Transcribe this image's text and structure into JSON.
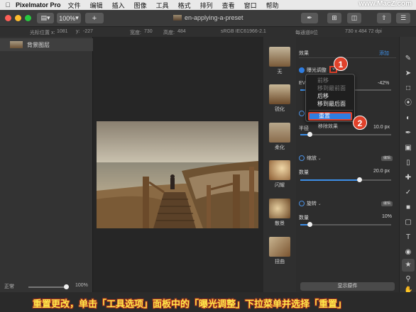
{
  "menubar": {
    "app_name": "Pixelmator Pro",
    "items": [
      "文件",
      "编辑",
      "插入",
      "图像",
      "工具",
      "格式",
      "排列",
      "查看",
      "窗口",
      "帮助"
    ],
    "watermark": "www.MacZ.com"
  },
  "toolbar": {
    "zoom": "100%",
    "add": "+",
    "doc_title": "en-applying-a-preset"
  },
  "infobar": {
    "cursor_label": "光标位置 x:",
    "x": "1081",
    "y_label": "y:",
    "y": "-227",
    "width_label": "宽度:",
    "width": "730",
    "height_label": "高度:",
    "height": "484",
    "color_profile": "sRGB IEC61966-2.1",
    "bit_depth": "每通道8位",
    "dimensions": "730 x 484 72 dpi"
  },
  "layers": {
    "items": [
      {
        "name": "背景图层"
      }
    ],
    "blend_mode": "正常",
    "opacity": "100%"
  },
  "presets": [
    {
      "label": "无"
    },
    {
      "label": "锐化"
    },
    {
      "label": "柔化"
    },
    {
      "label": "闪耀"
    },
    {
      "label": "散景"
    },
    {
      "label": "扭曲"
    }
  ],
  "effects": {
    "header": "效果",
    "add_label": "添加",
    "exposure": {
      "title": "曝光调整",
      "ev_label": "EV",
      "ev_value": "-42%",
      "ev_fraction": 0.29
    },
    "blur": {
      "radius_label": "半径",
      "radius_value": "10.0 px",
      "radius_fraction": 0.1
    },
    "zoom": {
      "title": "缩放",
      "tag": "编辑",
      "amount_label": "数量",
      "amount_value": "20.0 px",
      "amount_fraction": 0.65
    },
    "spin": {
      "title": "旋转",
      "tag": "编辑",
      "amount_label": "数量",
      "amount_value": "10%",
      "amount_fraction": 0.1
    },
    "show_original": "显示原件"
  },
  "popup_menu": {
    "items": [
      {
        "label": "前移",
        "enabled": false
      },
      {
        "label": "移到最前面",
        "enabled": false
      },
      {
        "label": "后移",
        "enabled": true
      },
      {
        "label": "移到最后面",
        "enabled": true
      },
      {
        "label": "重置",
        "enabled": true,
        "highlighted": true
      }
    ],
    "underlying_text": "移除效果"
  },
  "annotations": {
    "step1": "1",
    "step2": "2"
  },
  "caption": "重置更改，单击「工具选项」面板中的「曝光调整」下拉菜单并选择「重置」",
  "colors": {
    "accent": "#2f7de1",
    "badge": "#e0412a",
    "caption": "#ffe94a",
    "highlight_box": "#e0412a"
  }
}
